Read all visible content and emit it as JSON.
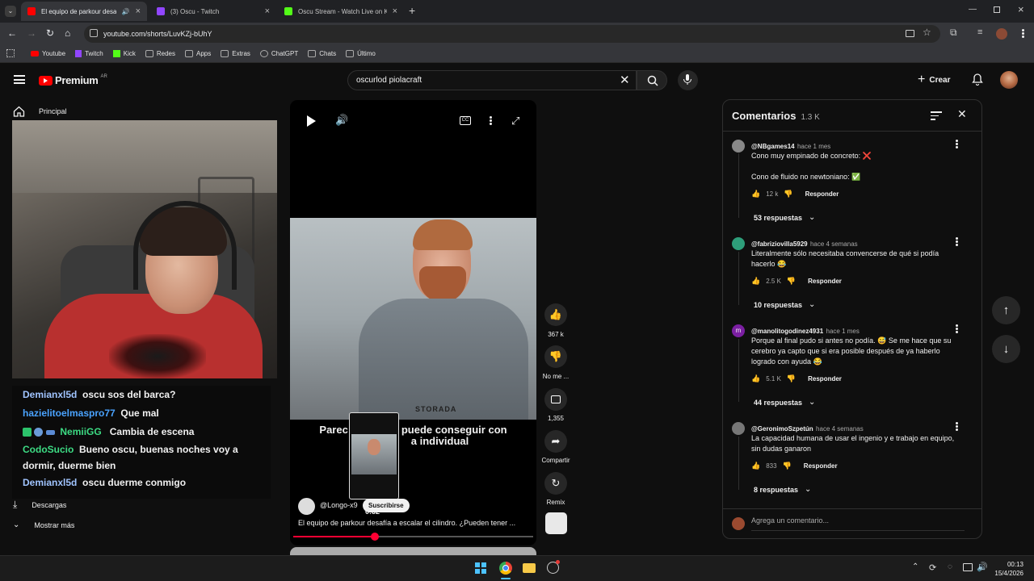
{
  "browser": {
    "tabs": [
      {
        "title": "El equipo de parkour desafí",
        "active": true,
        "color": "#ff0000"
      },
      {
        "title": "(3) Oscu - Twitch",
        "active": false,
        "color": "#9146ff"
      },
      {
        "title": "Oscu Stream - Watch Live on K",
        "active": false,
        "color": "#53fc18"
      }
    ],
    "url": "youtube.com/shorts/LuvKZj-bUhY",
    "bookmarks": [
      "Youtube",
      "Twitch",
      "Kick",
      "Redes",
      "Apps",
      "Extras",
      "ChatGPT",
      "Chats",
      "Último"
    ]
  },
  "youtube": {
    "logo": "Premium",
    "region": "AR",
    "search_value": "oscurlod piolacraft",
    "create_label": "Crear",
    "sidebar": {
      "home": "Principal",
      "downloads": "Descargas",
      "more": "Mostrar más"
    }
  },
  "stream_chat": [
    {
      "user": "Demianxl5d",
      "color": "#a0c4ff",
      "msg": "oscu sos del barca?"
    },
    {
      "user": "hazielitoelmaspro77",
      "color": "#4aa3ff",
      "msg": "Que mal"
    },
    {
      "user": "NemiiGG",
      "color": "#3ddc84",
      "msg": "Cambia de escena",
      "badges": true
    },
    {
      "user": "CodoSucio",
      "color": "#3ddc84",
      "msg": "Bueno oscu, buenas noches voy a dormir, duerme bien"
    },
    {
      "user": "Demianxl5d",
      "color": "#a0c4ff",
      "msg": "oscu duerme conmigo"
    }
  ],
  "short": {
    "caption": "Parec... puede conseguir con ... individual",
    "caption_a": "Parec",
    "caption_b": "puede conseguir con",
    "caption_c": "a individual",
    "channel": "@Longo-x9",
    "subscribe": "Suscribirse",
    "time": "0:32",
    "title": "El equipo de parkour desafía a escalar el cilindro. ¿Pueden tener ...",
    "hoodie_text": "STORADA",
    "progress": 0.34,
    "actions": {
      "likes": "367 k",
      "dislike": "No me ...",
      "comments": "1,355",
      "share": "Compartir",
      "remix": "Remix"
    }
  },
  "comments": {
    "title": "Comentarios",
    "count": "1.3 K",
    "input_placeholder": "Agrega un comentario...",
    "items": [
      {
        "user": "@NBgames14",
        "time": "hace 1 mes",
        "text1": "Cono muy empinado de concreto: ❌",
        "text2": "Cono de fluido no newtoniano: ✅",
        "likes": "12 k",
        "reply": "Responder",
        "replies": "53 respuestas",
        "avatar": "#888"
      },
      {
        "user": "@fabriziovilla5929",
        "time": "hace 4 semanas",
        "text1": "Literalmente sólo necesitaba convencerse de qué si podía hacerlo 😂",
        "likes": "2.5 K",
        "reply": "Responder",
        "replies": "10 respuestas",
        "avatar": "#2e9e7a"
      },
      {
        "user": "@manolitogodinez4931",
        "time": "hace 1 mes",
        "text1": "Porque al final pudo si antes no podía. 😅 Se me hace que su cerebro ya capto que si era posible después de ya haberlo logrado con ayuda 😂",
        "likes": "5.1 K",
        "reply": "Responder",
        "replies": "44 respuestas",
        "avatar": "#7b1fa2"
      },
      {
        "user": "@GeronimoSzpetún",
        "time": "hace 4 semanas",
        "text1": "La capacidad humana de usar el ingenio y e trabajo en equipo, sin dudas ganaron",
        "likes": "833",
        "reply": "Responder",
        "replies": "8 respuestas",
        "avatar": "#777"
      }
    ]
  },
  "taskbar": {
    "time": "00:13",
    "date": "15/4/2026"
  }
}
